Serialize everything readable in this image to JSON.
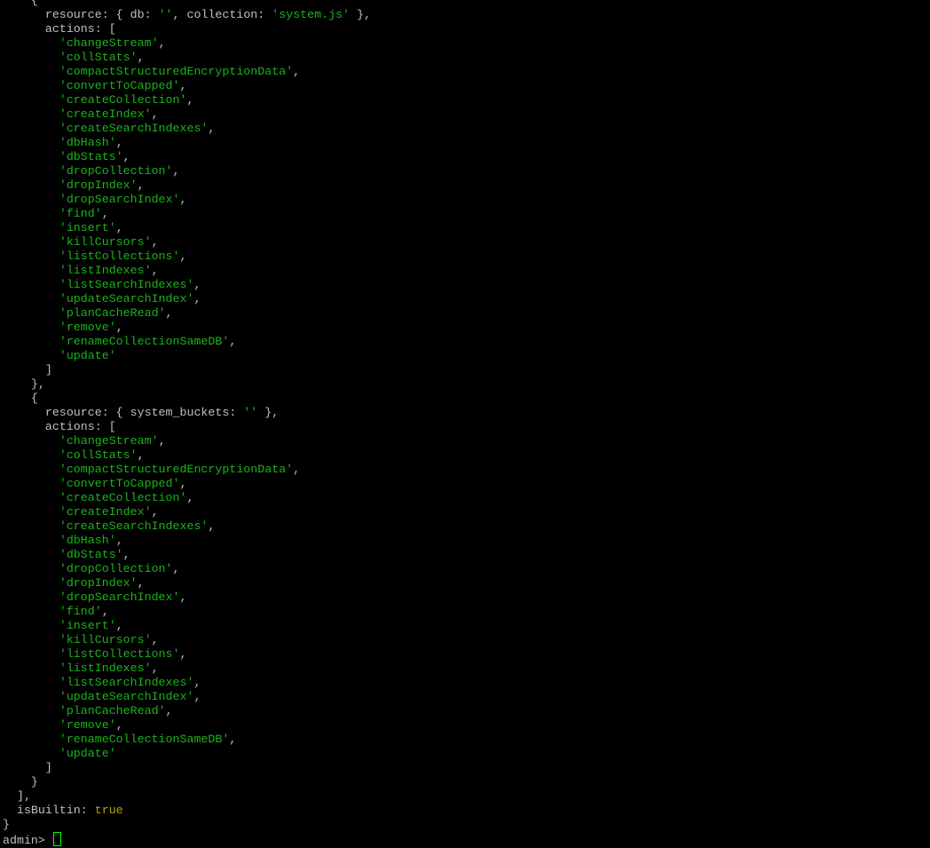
{
  "terminal": {
    "colors": {
      "background": "#000000",
      "plain": "#c0c0c0",
      "string": "#1bb31b",
      "boolean": "#b5a800",
      "cursor": "#00ff00"
    },
    "lines": [
      [
        {
          "t": "    {",
          "c": "plain"
        }
      ],
      [
        {
          "t": "      resource: { db: ",
          "c": "plain"
        },
        {
          "t": "''",
          "c": "str"
        },
        {
          "t": ", collection: ",
          "c": "plain"
        },
        {
          "t": "'system.js'",
          "c": "str"
        },
        {
          "t": " },",
          "c": "plain"
        }
      ],
      [
        {
          "t": "      actions: [",
          "c": "plain"
        }
      ],
      [
        {
          "t": "        ",
          "c": "plain"
        },
        {
          "t": "'changeStream'",
          "c": "str"
        },
        {
          "t": ",",
          "c": "plain"
        }
      ],
      [
        {
          "t": "        ",
          "c": "plain"
        },
        {
          "t": "'collStats'",
          "c": "str"
        },
        {
          "t": ",",
          "c": "plain"
        }
      ],
      [
        {
          "t": "        ",
          "c": "plain"
        },
        {
          "t": "'compactStructuredEncryptionData'",
          "c": "str"
        },
        {
          "t": ",",
          "c": "plain"
        }
      ],
      [
        {
          "t": "        ",
          "c": "plain"
        },
        {
          "t": "'convertToCapped'",
          "c": "str"
        },
        {
          "t": ",",
          "c": "plain"
        }
      ],
      [
        {
          "t": "        ",
          "c": "plain"
        },
        {
          "t": "'createCollection'",
          "c": "str"
        },
        {
          "t": ",",
          "c": "plain"
        }
      ],
      [
        {
          "t": "        ",
          "c": "plain"
        },
        {
          "t": "'createIndex'",
          "c": "str"
        },
        {
          "t": ",",
          "c": "plain"
        }
      ],
      [
        {
          "t": "        ",
          "c": "plain"
        },
        {
          "t": "'createSearchIndexes'",
          "c": "str"
        },
        {
          "t": ",",
          "c": "plain"
        }
      ],
      [
        {
          "t": "        ",
          "c": "plain"
        },
        {
          "t": "'dbHash'",
          "c": "str"
        },
        {
          "t": ",",
          "c": "plain"
        }
      ],
      [
        {
          "t": "        ",
          "c": "plain"
        },
        {
          "t": "'dbStats'",
          "c": "str"
        },
        {
          "t": ",",
          "c": "plain"
        }
      ],
      [
        {
          "t": "        ",
          "c": "plain"
        },
        {
          "t": "'dropCollection'",
          "c": "str"
        },
        {
          "t": ",",
          "c": "plain"
        }
      ],
      [
        {
          "t": "        ",
          "c": "plain"
        },
        {
          "t": "'dropIndex'",
          "c": "str"
        },
        {
          "t": ",",
          "c": "plain"
        }
      ],
      [
        {
          "t": "        ",
          "c": "plain"
        },
        {
          "t": "'dropSearchIndex'",
          "c": "str"
        },
        {
          "t": ",",
          "c": "plain"
        }
      ],
      [
        {
          "t": "        ",
          "c": "plain"
        },
        {
          "t": "'find'",
          "c": "str"
        },
        {
          "t": ",",
          "c": "plain"
        }
      ],
      [
        {
          "t": "        ",
          "c": "plain"
        },
        {
          "t": "'insert'",
          "c": "str"
        },
        {
          "t": ",",
          "c": "plain"
        }
      ],
      [
        {
          "t": "        ",
          "c": "plain"
        },
        {
          "t": "'killCursors'",
          "c": "str"
        },
        {
          "t": ",",
          "c": "plain"
        }
      ],
      [
        {
          "t": "        ",
          "c": "plain"
        },
        {
          "t": "'listCollections'",
          "c": "str"
        },
        {
          "t": ",",
          "c": "plain"
        }
      ],
      [
        {
          "t": "        ",
          "c": "plain"
        },
        {
          "t": "'listIndexes'",
          "c": "str"
        },
        {
          "t": ",",
          "c": "plain"
        }
      ],
      [
        {
          "t": "        ",
          "c": "plain"
        },
        {
          "t": "'listSearchIndexes'",
          "c": "str"
        },
        {
          "t": ",",
          "c": "plain"
        }
      ],
      [
        {
          "t": "        ",
          "c": "plain"
        },
        {
          "t": "'updateSearchIndex'",
          "c": "str"
        },
        {
          "t": ",",
          "c": "plain"
        }
      ],
      [
        {
          "t": "        ",
          "c": "plain"
        },
        {
          "t": "'planCacheRead'",
          "c": "str"
        },
        {
          "t": ",",
          "c": "plain"
        }
      ],
      [
        {
          "t": "        ",
          "c": "plain"
        },
        {
          "t": "'remove'",
          "c": "str"
        },
        {
          "t": ",",
          "c": "plain"
        }
      ],
      [
        {
          "t": "        ",
          "c": "plain"
        },
        {
          "t": "'renameCollectionSameDB'",
          "c": "str"
        },
        {
          "t": ",",
          "c": "plain"
        }
      ],
      [
        {
          "t": "        ",
          "c": "plain"
        },
        {
          "t": "'update'",
          "c": "str"
        }
      ],
      [
        {
          "t": "      ]",
          "c": "plain"
        }
      ],
      [
        {
          "t": "    },",
          "c": "plain"
        }
      ],
      [
        {
          "t": "    {",
          "c": "plain"
        }
      ],
      [
        {
          "t": "      resource: { system_buckets: ",
          "c": "plain"
        },
        {
          "t": "''",
          "c": "str"
        },
        {
          "t": " },",
          "c": "plain"
        }
      ],
      [
        {
          "t": "      actions: [",
          "c": "plain"
        }
      ],
      [
        {
          "t": "        ",
          "c": "plain"
        },
        {
          "t": "'changeStream'",
          "c": "str"
        },
        {
          "t": ",",
          "c": "plain"
        }
      ],
      [
        {
          "t": "        ",
          "c": "plain"
        },
        {
          "t": "'collStats'",
          "c": "str"
        },
        {
          "t": ",",
          "c": "plain"
        }
      ],
      [
        {
          "t": "        ",
          "c": "plain"
        },
        {
          "t": "'compactStructuredEncryptionData'",
          "c": "str"
        },
        {
          "t": ",",
          "c": "plain"
        }
      ],
      [
        {
          "t": "        ",
          "c": "plain"
        },
        {
          "t": "'convertToCapped'",
          "c": "str"
        },
        {
          "t": ",",
          "c": "plain"
        }
      ],
      [
        {
          "t": "        ",
          "c": "plain"
        },
        {
          "t": "'createCollection'",
          "c": "str"
        },
        {
          "t": ",",
          "c": "plain"
        }
      ],
      [
        {
          "t": "        ",
          "c": "plain"
        },
        {
          "t": "'createIndex'",
          "c": "str"
        },
        {
          "t": ",",
          "c": "plain"
        }
      ],
      [
        {
          "t": "        ",
          "c": "plain"
        },
        {
          "t": "'createSearchIndexes'",
          "c": "str"
        },
        {
          "t": ",",
          "c": "plain"
        }
      ],
      [
        {
          "t": "        ",
          "c": "plain"
        },
        {
          "t": "'dbHash'",
          "c": "str"
        },
        {
          "t": ",",
          "c": "plain"
        }
      ],
      [
        {
          "t": "        ",
          "c": "plain"
        },
        {
          "t": "'dbStats'",
          "c": "str"
        },
        {
          "t": ",",
          "c": "plain"
        }
      ],
      [
        {
          "t": "        ",
          "c": "plain"
        },
        {
          "t": "'dropCollection'",
          "c": "str"
        },
        {
          "t": ",",
          "c": "plain"
        }
      ],
      [
        {
          "t": "        ",
          "c": "plain"
        },
        {
          "t": "'dropIndex'",
          "c": "str"
        },
        {
          "t": ",",
          "c": "plain"
        }
      ],
      [
        {
          "t": "        ",
          "c": "plain"
        },
        {
          "t": "'dropSearchIndex'",
          "c": "str"
        },
        {
          "t": ",",
          "c": "plain"
        }
      ],
      [
        {
          "t": "        ",
          "c": "plain"
        },
        {
          "t": "'find'",
          "c": "str"
        },
        {
          "t": ",",
          "c": "plain"
        }
      ],
      [
        {
          "t": "        ",
          "c": "plain"
        },
        {
          "t": "'insert'",
          "c": "str"
        },
        {
          "t": ",",
          "c": "plain"
        }
      ],
      [
        {
          "t": "        ",
          "c": "plain"
        },
        {
          "t": "'killCursors'",
          "c": "str"
        },
        {
          "t": ",",
          "c": "plain"
        }
      ],
      [
        {
          "t": "        ",
          "c": "plain"
        },
        {
          "t": "'listCollections'",
          "c": "str"
        },
        {
          "t": ",",
          "c": "plain"
        }
      ],
      [
        {
          "t": "        ",
          "c": "plain"
        },
        {
          "t": "'listIndexes'",
          "c": "str"
        },
        {
          "t": ",",
          "c": "plain"
        }
      ],
      [
        {
          "t": "        ",
          "c": "plain"
        },
        {
          "t": "'listSearchIndexes'",
          "c": "str"
        },
        {
          "t": ",",
          "c": "plain"
        }
      ],
      [
        {
          "t": "        ",
          "c": "plain"
        },
        {
          "t": "'updateSearchIndex'",
          "c": "str"
        },
        {
          "t": ",",
          "c": "plain"
        }
      ],
      [
        {
          "t": "        ",
          "c": "plain"
        },
        {
          "t": "'planCacheRead'",
          "c": "str"
        },
        {
          "t": ",",
          "c": "plain"
        }
      ],
      [
        {
          "t": "        ",
          "c": "plain"
        },
        {
          "t": "'remove'",
          "c": "str"
        },
        {
          "t": ",",
          "c": "plain"
        }
      ],
      [
        {
          "t": "        ",
          "c": "plain"
        },
        {
          "t": "'renameCollectionSameDB'",
          "c": "str"
        },
        {
          "t": ",",
          "c": "plain"
        }
      ],
      [
        {
          "t": "        ",
          "c": "plain"
        },
        {
          "t": "'update'",
          "c": "str"
        }
      ],
      [
        {
          "t": "      ]",
          "c": "plain"
        }
      ],
      [
        {
          "t": "    }",
          "c": "plain"
        }
      ],
      [
        {
          "t": "  ],",
          "c": "plain"
        }
      ],
      [
        {
          "t": "  isBuiltin: ",
          "c": "plain"
        },
        {
          "t": "true",
          "c": "bool"
        }
      ],
      [
        {
          "t": "}",
          "c": "plain"
        }
      ]
    ],
    "prompt": "admin> ",
    "input_value": ""
  }
}
